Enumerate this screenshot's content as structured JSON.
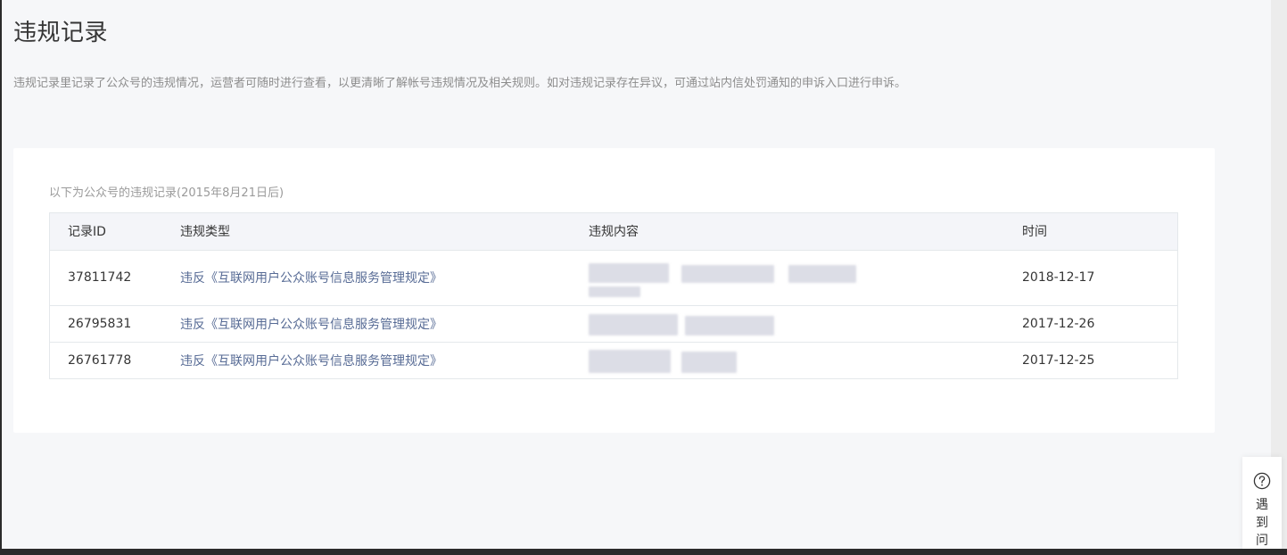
{
  "page": {
    "title": "违规记录",
    "description": "违规记录里记录了公众号的违规情况，运营者可随时进行查看，以更清晰了解帐号违规情况及相关规则。如对违规记录存在异议，可通过站内信处罚通知的申诉入口进行申诉。"
  },
  "records": {
    "caption": "以下为公众号的违规记录(2015年8月21日后)",
    "headers": {
      "id": "记录ID",
      "type": "违规类型",
      "content": "违规内容",
      "time": "时间"
    },
    "rows": [
      {
        "id": "37811742",
        "type": "违反《互联网用户公众账号信息服务管理规定》",
        "time": "2018-12-17"
      },
      {
        "id": "26795831",
        "type": "违反《互联网用户公众账号信息服务管理规定》",
        "time": "2017-12-26"
      },
      {
        "id": "26761778",
        "type": "违反《互联网用户公众账号信息服务管理规定》",
        "time": "2017-12-25"
      }
    ]
  },
  "help": {
    "label": "遇到问",
    "icon": "question-circle-icon"
  },
  "colors": {
    "page_bg": "#f6f7f9",
    "link": "#576b95",
    "text": "#353535",
    "muted": "#8d8d8d"
  }
}
